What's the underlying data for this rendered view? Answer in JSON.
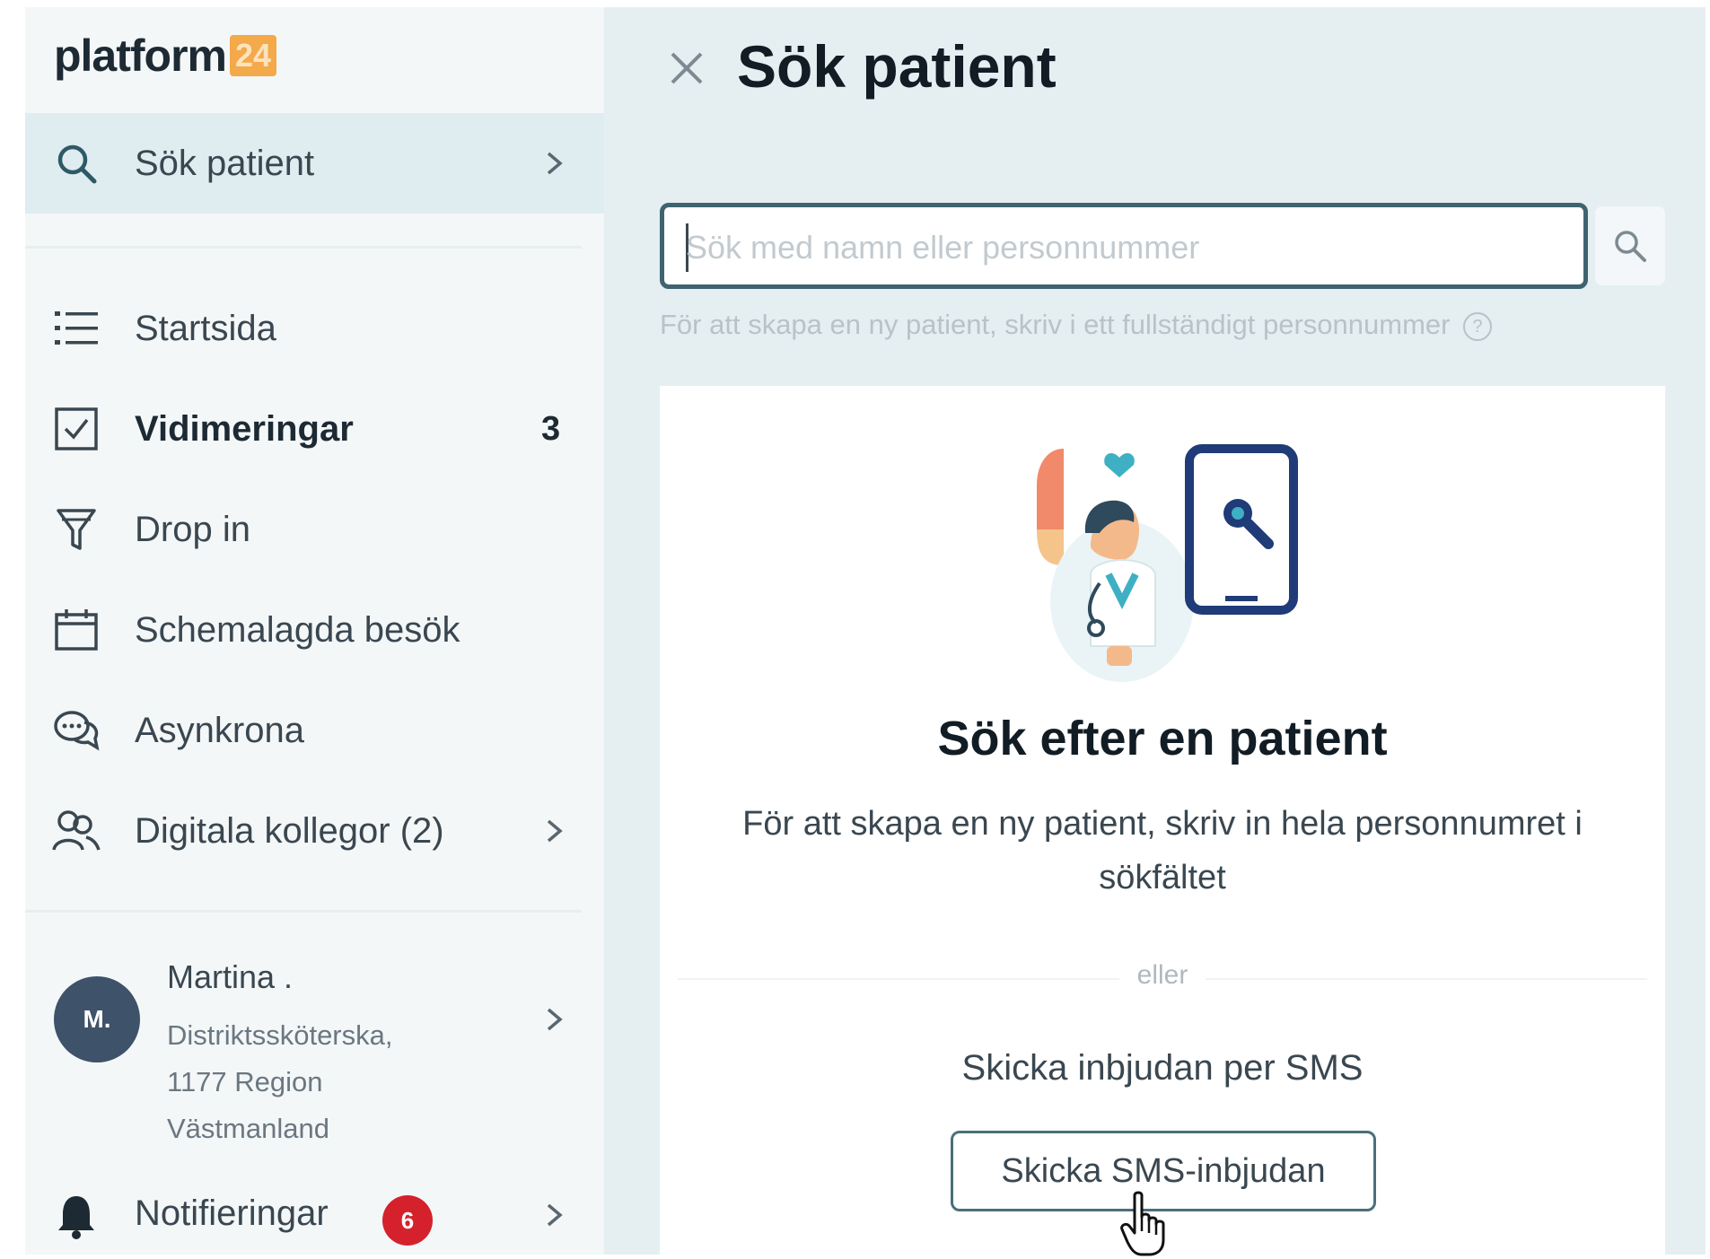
{
  "logo": {
    "word": "platform",
    "badge": "24"
  },
  "sidebar": {
    "search_item": {
      "label": "Sök patient",
      "icon": "search-icon"
    },
    "items": [
      {
        "label": "Startsida",
        "icon": "list-icon",
        "count": ""
      },
      {
        "label": "Vidimeringar",
        "icon": "checkbox-icon",
        "count": "3"
      },
      {
        "label": "Drop in",
        "icon": "funnel-icon",
        "count": ""
      },
      {
        "label": "Schemalagda besök",
        "icon": "calendar-icon",
        "count": ""
      },
      {
        "label": "Asynkrona",
        "icon": "chat-icon",
        "count": ""
      },
      {
        "label": "Digitala kollegor (2)",
        "icon": "people-icon",
        "count": ""
      }
    ],
    "profile": {
      "initials": "M.",
      "name": "Martina .",
      "role": "Distriktssköterska, 1177 Region Västmanland"
    },
    "notifications": {
      "label": "Notifieringar",
      "count": "6"
    }
  },
  "main": {
    "title": "Sök patient",
    "search": {
      "placeholder": "Sök med namn eller personnummer",
      "hint": "För att skapa en ny patient, skriv i ett fullständigt personnummer"
    },
    "card": {
      "title": "Sök efter en patient",
      "text": "För att skapa en ny patient, skriv in hela personnumret i sökfältet",
      "or_label": "eller",
      "sms_text": "Skicka inbjudan per SMS",
      "sms_button": "Skicka SMS-inbjudan"
    }
  },
  "colors": {
    "accent": "#3f6470",
    "badge_red": "#d5212b",
    "avatar": "#3e5269",
    "logo_orange": "#f4a94a"
  }
}
